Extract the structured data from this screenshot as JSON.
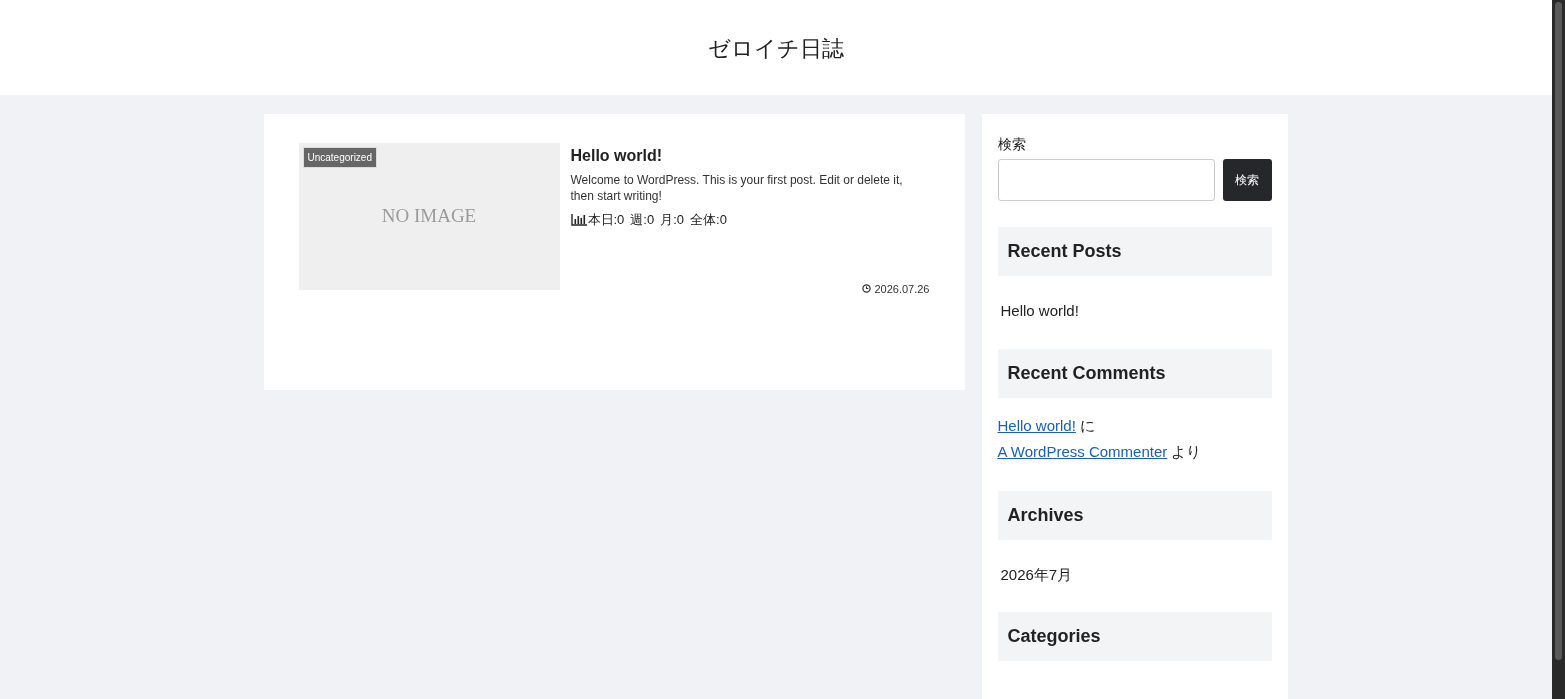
{
  "site_title": "ゼロイチ日誌",
  "posts": [
    {
      "category": "Uncategorized",
      "image_text": "NO IMAGE",
      "title": "Hello world!",
      "excerpt": "Welcome to WordPress. This is your first post. Edit or delete it, then start writing!",
      "stats": [
        "本日:0",
        "週:0",
        "月:0",
        "全体:0"
      ],
      "date": "2026.07.26"
    }
  ],
  "sidebar": {
    "search": {
      "label": "検索",
      "button": "検索"
    },
    "widgets": [
      {
        "kind": "list",
        "title": "Recent Posts",
        "items": [
          "Hello world!"
        ]
      },
      {
        "kind": "comments",
        "title": "Recent Comments",
        "comments": [
          {
            "post": "Hello world!",
            "joiner": "に",
            "author": "A WordPress Commenter",
            "tail": "より"
          }
        ]
      },
      {
        "kind": "list",
        "title": "Archives",
        "items": [
          "2026年7月"
        ]
      },
      {
        "kind": "list",
        "title": "Categories"
      }
    ]
  }
}
